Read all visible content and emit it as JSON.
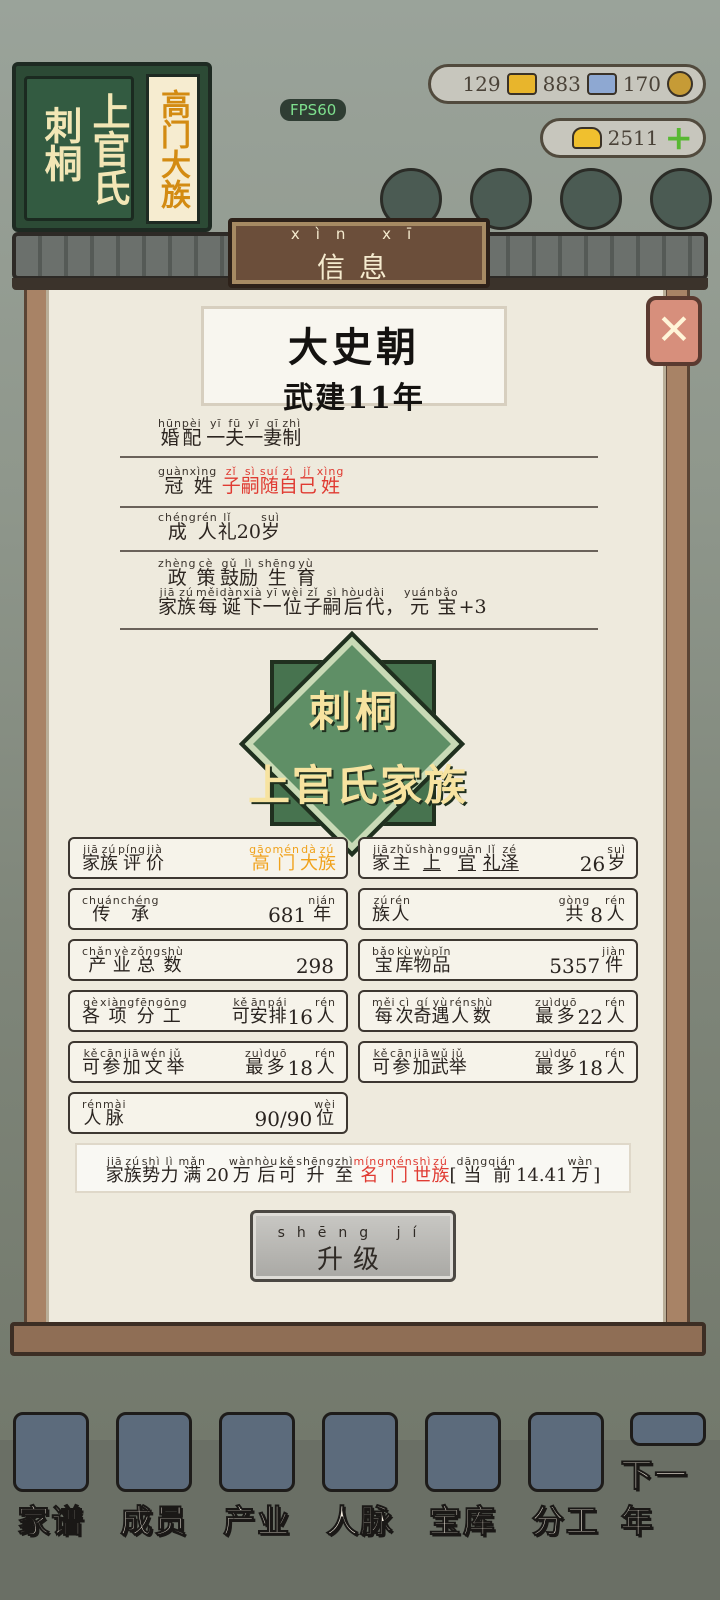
{
  "hud": {
    "family_place": "刺桐",
    "family_surname": "上官氏",
    "family_rank": "高门大族",
    "fps": "FPS60",
    "resources": {
      "gold": "129",
      "silver": "883",
      "coins": "170",
      "ingots": "2511"
    }
  },
  "modal": {
    "title": "信息",
    "title_pinyin": "xìn xī",
    "dynasty": "大史朝",
    "era_year": "武建11年",
    "policies": [
      {
        "segments": [
          {
            "c": "婚",
            "p": "hūn"
          },
          {
            "c": "配",
            "p": "pèi"
          },
          {
            "c": " ",
            "p": ""
          },
          {
            "c": "一",
            "p": "yī"
          },
          {
            "c": "夫",
            "p": "fū"
          },
          {
            "c": "一",
            "p": "yī"
          },
          {
            "c": "妻",
            "p": "qī"
          },
          {
            "c": "制",
            "p": "zhì"
          }
        ]
      },
      {
        "segments": [
          {
            "c": "冠",
            "p": "guàn"
          },
          {
            "c": "姓",
            "p": "xìng"
          },
          {
            "c": " ",
            "p": ""
          },
          {
            "c": "子",
            "p": "zǐ",
            "red": true
          },
          {
            "c": "嗣",
            "p": "sì",
            "red": true
          },
          {
            "c": "随",
            "p": "suí",
            "red": true
          },
          {
            "c": "自",
            "p": "zì",
            "red": true
          },
          {
            "c": "己",
            "p": "jǐ",
            "red": true
          },
          {
            "c": "姓",
            "p": "xìng",
            "red": true
          }
        ]
      },
      {
        "segments": [
          {
            "c": "成",
            "p": "chéng"
          },
          {
            "c": "人",
            "p": "rén"
          },
          {
            "c": "礼",
            "p": "lǐ"
          },
          {
            "c": " 20",
            "p": ""
          },
          {
            "c": "岁",
            "p": "suì"
          }
        ]
      },
      {
        "segments": [
          {
            "c": "政",
            "p": "zhèng"
          },
          {
            "c": "策",
            "p": "cè"
          },
          {
            "c": " ",
            "p": ""
          },
          {
            "c": "鼓",
            "p": "gǔ"
          },
          {
            "c": "励",
            "p": "lì"
          },
          {
            "c": "生",
            "p": "shēng"
          },
          {
            "c": "育",
            "p": "yù"
          }
        ],
        "detail": [
          {
            "c": "家",
            "p": "jiā"
          },
          {
            "c": "族",
            "p": "zú"
          },
          {
            "c": "每",
            "p": "měi"
          },
          {
            "c": "诞",
            "p": "dàn"
          },
          {
            "c": "下",
            "p": "xià"
          },
          {
            "c": "一",
            "p": "yī"
          },
          {
            "c": "位",
            "p": "wèi"
          },
          {
            "c": "子",
            "p": "zǐ"
          },
          {
            "c": "嗣",
            "p": "sì"
          },
          {
            "c": "后",
            "p": "hòu"
          },
          {
            "c": "代",
            "p": "dài"
          },
          {
            "c": "，",
            "p": ""
          },
          {
            "c": "元",
            "p": "yuán"
          },
          {
            "c": "宝",
            "p": "bǎo"
          },
          {
            "c": "+3",
            "p": ""
          }
        ]
      }
    ],
    "crest": {
      "place": "刺桐",
      "family": "上官氏家族"
    },
    "stats": [
      {
        "label": [
          {
            "c": "家",
            "p": "jiā"
          },
          {
            "c": "族",
            "p": "zú"
          },
          {
            "c": "评",
            "p": "píng"
          },
          {
            "c": "价",
            "p": "jià"
          }
        ],
        "value": [
          {
            "c": "高",
            "p": "gāo",
            "orange": true
          },
          {
            "c": "门",
            "p": "mén",
            "orange": true
          },
          {
            "c": "大",
            "p": "dà",
            "orange": true
          },
          {
            "c": "族",
            "p": "zú",
            "orange": true
          }
        ]
      },
      {
        "label": [
          {
            "c": "家",
            "p": "jiā"
          },
          {
            "c": "主",
            "p": "zhǔ"
          },
          {
            "c": "上",
            "p": "shàng",
            "u": true
          },
          {
            "c": "官",
            "p": "guān",
            "u": true
          },
          {
            "c": "礼",
            "p": "lǐ",
            "u": true
          },
          {
            "c": "泽",
            "p": "zé",
            "u": true
          }
        ],
        "value": [
          {
            "c": "26",
            "p": "",
            "num": true
          },
          {
            "c": "岁",
            "p": "suì"
          }
        ]
      },
      {
        "label": [
          {
            "c": "传",
            "p": "chuán"
          },
          {
            "c": "承",
            "p": "chéng"
          }
        ],
        "value": [
          {
            "c": "681",
            "p": "",
            "num": true
          },
          {
            "c": "年",
            "p": "nián"
          }
        ]
      },
      {
        "label": [
          {
            "c": "族",
            "p": "zú"
          },
          {
            "c": "人",
            "p": "rén"
          }
        ],
        "value": [
          {
            "c": "共",
            "p": "gòng"
          },
          {
            "c": "8",
            "p": "",
            "num": true
          },
          {
            "c": "人",
            "p": "rén"
          }
        ]
      },
      {
        "label": [
          {
            "c": "产",
            "p": "chǎn"
          },
          {
            "c": "业",
            "p": "yè"
          },
          {
            "c": "总",
            "p": "zǒng"
          },
          {
            "c": "数",
            "p": "shù"
          }
        ],
        "value": [
          {
            "c": "298",
            "p": "",
            "num": true
          }
        ]
      },
      {
        "label": [
          {
            "c": "宝",
            "p": "bǎo"
          },
          {
            "c": "库",
            "p": "kù"
          },
          {
            "c": "物",
            "p": "wù"
          },
          {
            "c": "品",
            "p": "pǐn"
          }
        ],
        "value": [
          {
            "c": "5357",
            "p": "",
            "num": true
          },
          {
            "c": "件",
            "p": "jiàn"
          }
        ]
      },
      {
        "label": [
          {
            "c": "各",
            "p": "gè"
          },
          {
            "c": "项",
            "p": "xiàng"
          },
          {
            "c": "分",
            "p": "fēn"
          },
          {
            "c": "工",
            "p": "gōng"
          }
        ],
        "value": [
          {
            "c": "可",
            "p": "kě"
          },
          {
            "c": "安",
            "p": "ān"
          },
          {
            "c": "排",
            "p": "pái"
          },
          {
            "c": "16",
            "p": "",
            "num": true
          },
          {
            "c": "人",
            "p": "rén"
          }
        ]
      },
      {
        "label": [
          {
            "c": "每",
            "p": "měi"
          },
          {
            "c": "次",
            "p": "cì"
          },
          {
            "c": "奇",
            "p": "qí"
          },
          {
            "c": "遇",
            "p": "yù"
          },
          {
            "c": "人",
            "p": "rén"
          },
          {
            "c": "数",
            "p": "shù"
          }
        ],
        "value": [
          {
            "c": "最",
            "p": "zuì"
          },
          {
            "c": "多",
            "p": "duō"
          },
          {
            "c": "22",
            "p": "",
            "num": true
          },
          {
            "c": "人",
            "p": "rén"
          }
        ]
      },
      {
        "label": [
          {
            "c": "可",
            "p": "kě"
          },
          {
            "c": "参",
            "p": "cān"
          },
          {
            "c": "加",
            "p": "jiā"
          },
          {
            "c": "文",
            "p": "wén"
          },
          {
            "c": "举",
            "p": "jǔ"
          }
        ],
        "value": [
          {
            "c": "最",
            "p": "zuì"
          },
          {
            "c": "多",
            "p": "duō"
          },
          {
            "c": "18",
            "p": "",
            "num": true
          },
          {
            "c": "人",
            "p": "rén"
          }
        ]
      },
      {
        "label": [
          {
            "c": "可",
            "p": "kě"
          },
          {
            "c": "参",
            "p": "cān"
          },
          {
            "c": "加",
            "p": "jiā"
          },
          {
            "c": "武",
            "p": "wǔ"
          },
          {
            "c": "举",
            "p": "jǔ"
          }
        ],
        "value": [
          {
            "c": "最",
            "p": "zuì"
          },
          {
            "c": "多",
            "p": "duō"
          },
          {
            "c": "18",
            "p": "",
            "num": true
          },
          {
            "c": "人",
            "p": "rén"
          }
        ]
      },
      {
        "label": [
          {
            "c": "人",
            "p": "rén"
          },
          {
            "c": "脉",
            "p": "mài"
          }
        ],
        "value": [
          {
            "c": "90/90",
            "p": "",
            "num": true
          },
          {
            "c": "位",
            "p": "wèi"
          }
        ]
      }
    ],
    "requirement": [
      {
        "c": "家",
        "p": "jiā"
      },
      {
        "c": "族",
        "p": "zú"
      },
      {
        "c": "势",
        "p": "shì"
      },
      {
        "c": "力",
        "p": "lì"
      },
      {
        "c": "满",
        "p": "mǎn"
      },
      {
        "c": "20",
        "p": ""
      },
      {
        "c": "万",
        "p": "wàn"
      },
      {
        "c": "后",
        "p": "hòu"
      },
      {
        "c": "可",
        "p": "kě"
      },
      {
        "c": "升",
        "p": "shēng"
      },
      {
        "c": "至",
        "p": "zhì"
      },
      {
        "c": "名",
        "p": "míng",
        "red": true
      },
      {
        "c": "门",
        "p": "mén",
        "red": true
      },
      {
        "c": "世",
        "p": "shì",
        "red": true
      },
      {
        "c": "族",
        "p": "zú",
        "red": true
      },
      {
        "c": "[",
        "p": ""
      },
      {
        "c": "当",
        "p": "dāng"
      },
      {
        "c": "前",
        "p": "qián"
      },
      {
        "c": "14.41",
        "p": ""
      },
      {
        "c": "万",
        "p": "wàn"
      },
      {
        "c": "]",
        "p": ""
      }
    ],
    "upgrade_label": "升级",
    "upgrade_pinyin": "shēng jí",
    "close_symbol": "✕"
  },
  "bottom_nav": [
    {
      "label": "家谱",
      "icon": "genealogy-book-icon"
    },
    {
      "label": "成员",
      "icon": "member-portrait-icon"
    },
    {
      "label": "产业",
      "icon": "pavilion-icon"
    },
    {
      "label": "人脉",
      "icon": "network-icon"
    },
    {
      "label": "宝库",
      "icon": "treasure-chest-icon"
    },
    {
      "label": "分工",
      "icon": "scroll-icon"
    },
    {
      "label": "下一年",
      "icon": "lantern-icon"
    }
  ]
}
